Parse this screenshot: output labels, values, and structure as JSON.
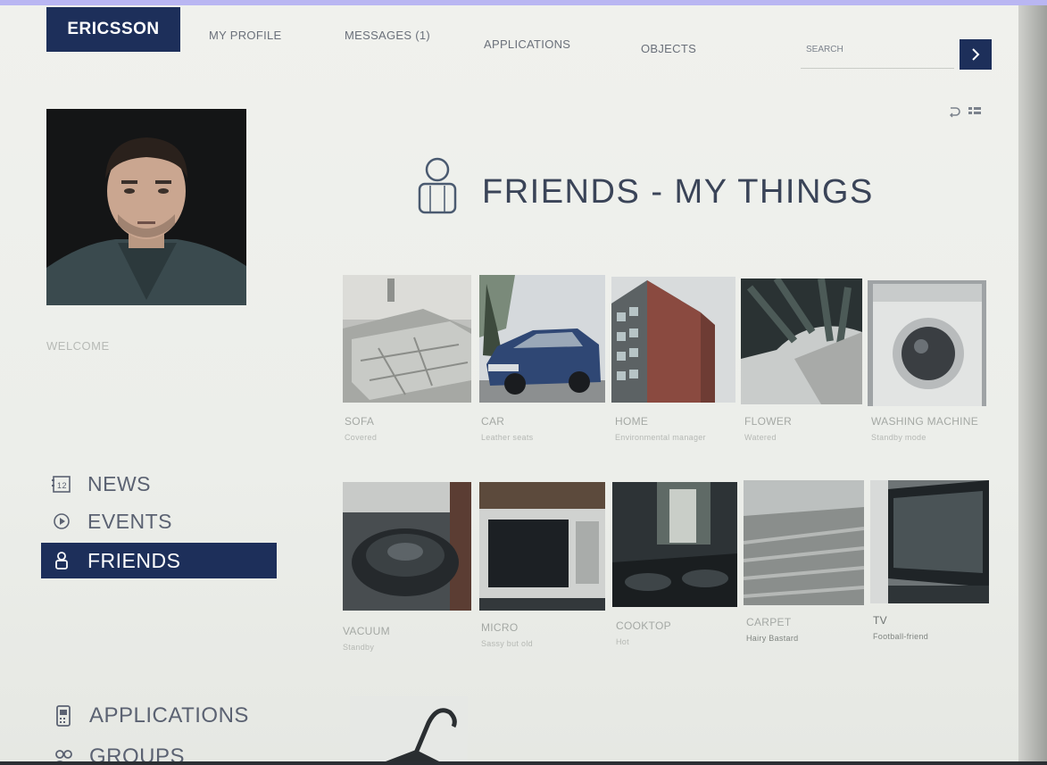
{
  "header": {
    "logo": "ERICSSON",
    "nav": [
      "MY PROFILE",
      "MESSAGES (1)",
      "APPLICATIONS",
      "OBJECTS"
    ],
    "search_placeholder": "SEARCH"
  },
  "sidebar": {
    "welcome": "WELCOME",
    "items": [
      {
        "label": "NEWS",
        "icon": "calendar-icon"
      },
      {
        "label": "EVENTS",
        "icon": "play-circle-icon"
      },
      {
        "label": "FRIENDS",
        "icon": "person-icon",
        "active": true
      }
    ],
    "bottom_items": [
      {
        "label": "APPLICATIONS",
        "icon": "phone-icon"
      },
      {
        "label": "GROUPS",
        "icon": "group-icon"
      }
    ]
  },
  "main": {
    "title": "FRIENDS - MY THINGS",
    "things": [
      {
        "name": "SOFA",
        "status": "Covered"
      },
      {
        "name": "CAR",
        "status": "Leather seats"
      },
      {
        "name": "HOME",
        "status": "Environmental manager"
      },
      {
        "name": "FLOWER",
        "status": "Watered"
      },
      {
        "name": "WASHING MACHINE",
        "status": "Standby mode"
      },
      {
        "name": "VACUUM",
        "status": "Standby"
      },
      {
        "name": "MICRO",
        "status": "Sassy but old"
      },
      {
        "name": "COOKTOP",
        "status": "Hot"
      },
      {
        "name": "CARPET",
        "status": "Hairy Bastard"
      },
      {
        "name": "TV",
        "status": "Football-friend"
      }
    ]
  },
  "colors": {
    "accent": "#1d2f5a",
    "page_bg": "#eceeea"
  }
}
